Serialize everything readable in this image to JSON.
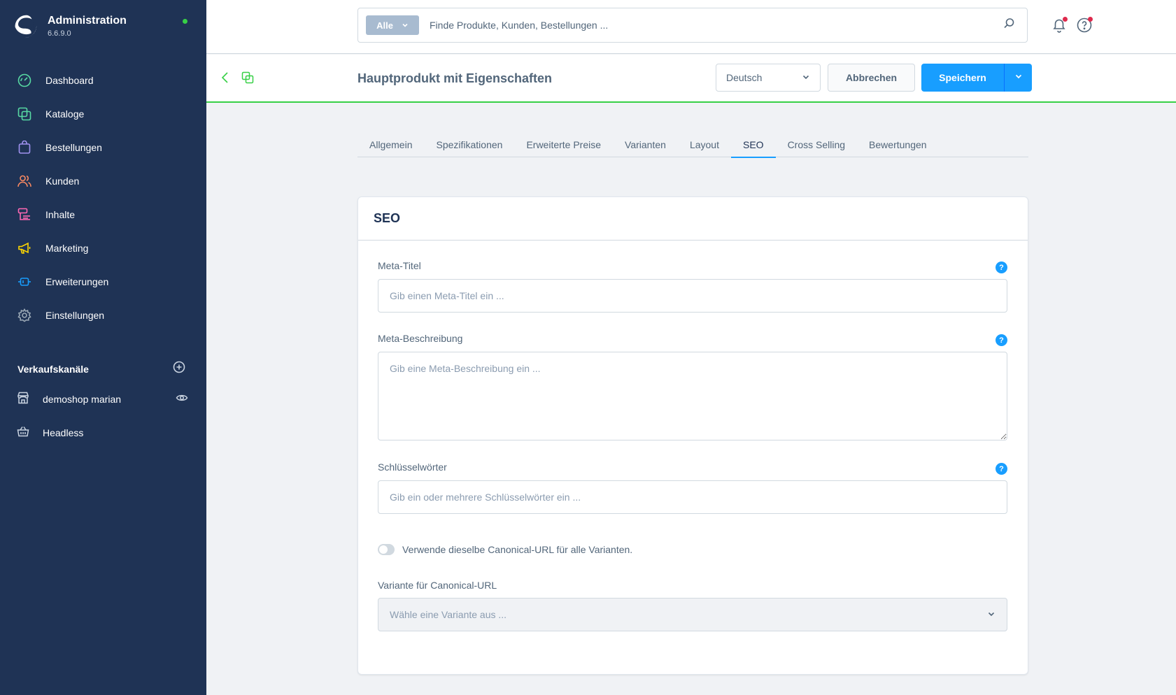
{
  "app": {
    "title": "Administration",
    "version": "6.6.9.0",
    "status_color": "#37d046"
  },
  "sidebar": {
    "items": [
      {
        "label": "Dashboard",
        "icon": "dashboard-icon",
        "color": "#57d9a3"
      },
      {
        "label": "Kataloge",
        "icon": "catalog-icon",
        "color": "#57d9a3"
      },
      {
        "label": "Bestellungen",
        "icon": "orders-icon",
        "color": "#a092f0"
      },
      {
        "label": "Kunden",
        "icon": "customers-icon",
        "color": "#f88962"
      },
      {
        "label": "Inhalte",
        "icon": "content-icon",
        "color": "#ff68b4"
      },
      {
        "label": "Marketing",
        "icon": "marketing-icon",
        "color": "#ffd700"
      },
      {
        "label": "Erweiterungen",
        "icon": "extensions-icon",
        "color": "#189eff"
      },
      {
        "label": "Einstellungen",
        "icon": "settings-icon",
        "color": "#9aa8b5"
      }
    ],
    "channels_title": "Verkaufskanäle",
    "channels": [
      {
        "label": "demoshop marian"
      },
      {
        "label": "Headless"
      }
    ]
  },
  "search": {
    "type_label": "Alle",
    "placeholder": "Finde Produkte, Kunden, Bestellungen ..."
  },
  "smartbar": {
    "title": "Hauptprodukt mit Eigenschaften",
    "language": "Deutsch",
    "cancel_label": "Abbrechen",
    "save_label": "Speichern"
  },
  "tabs": [
    {
      "label": "Allgemein"
    },
    {
      "label": "Spezifikationen"
    },
    {
      "label": "Erweiterte Preise"
    },
    {
      "label": "Varianten"
    },
    {
      "label": "Layout"
    },
    {
      "label": "SEO",
      "active": true
    },
    {
      "label": "Cross Selling"
    },
    {
      "label": "Bewertungen"
    }
  ],
  "seo": {
    "card_title": "SEO",
    "meta_title": {
      "label": "Meta-Titel",
      "placeholder": "Gib einen Meta-Titel ein ..."
    },
    "meta_description": {
      "label": "Meta-Beschreibung",
      "placeholder": "Gib eine Meta-Beschreibung ein ..."
    },
    "keywords": {
      "label": "Schlüsselwörter",
      "placeholder": "Gib ein oder mehrere Schlüsselwörter ein ..."
    },
    "canonical_toggle": {
      "label": "Verwende dieselbe Canonical-URL für alle Varianten.",
      "checked": false
    },
    "canonical_variant": {
      "label": "Variante für Canonical-URL",
      "placeholder": "Wähle eine Variante aus ..."
    }
  },
  "colors": {
    "accent": "#189eff",
    "sidebar_bg": "#1f3355",
    "success": "#37d046"
  }
}
